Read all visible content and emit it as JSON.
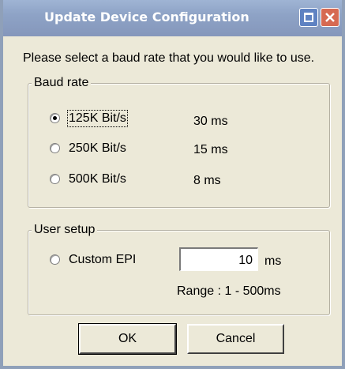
{
  "window": {
    "title": "Update Device Configuration"
  },
  "prompt": "Please select a baud rate that you would like to use.",
  "baud_group": {
    "label": "Baud rate",
    "options": [
      {
        "label": "125K Bit/s",
        "timing": "30 ms",
        "checked": true
      },
      {
        "label": "250K Bit/s",
        "timing": "15 ms",
        "checked": false
      },
      {
        "label": "500K Bit/s",
        "timing": "8 ms",
        "checked": false
      }
    ]
  },
  "user_group": {
    "label": "User setup",
    "custom_label": "Custom EPI",
    "custom_checked": false,
    "epi_value": "10",
    "unit": "ms",
    "range": "Range : 1 - 500ms"
  },
  "buttons": {
    "ok": "OK",
    "cancel": "Cancel"
  },
  "colors": {
    "dialog_bg": "#ece9d8",
    "titlebar": "#8ea3c6",
    "close_button": "#d66a52",
    "maximize_button": "#5f82c2"
  }
}
